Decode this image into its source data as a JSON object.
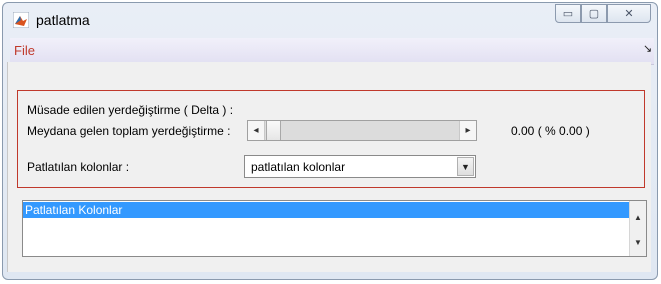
{
  "window": {
    "title": "patlatma",
    "icon": "matlab-icon",
    "controls": {
      "minimize": "▭",
      "maximize": "▢",
      "close": "✕"
    }
  },
  "menubar": {
    "items": [
      {
        "label": "File"
      }
    ],
    "overflow_glyph": "↘"
  },
  "panel": {
    "delta_label": "Müsade edilen yerdeğiştirme ( Delta ) :",
    "total_label": "Meydana gelen toplam yerdeğiştirme :",
    "slider": {
      "value": 0.0,
      "left_arrow": "◂",
      "right_arrow": "▸"
    },
    "value_text": "0.00  ( % 0.00 )",
    "columns_label": "Patlatılan kolonlar :",
    "columns_select": {
      "selected": "patlatılan kolonlar",
      "arrow": "▼"
    }
  },
  "listbox": {
    "items": [
      {
        "label": "Patlatılan Kolonlar",
        "selected": true
      }
    ],
    "scroll_up": "▲",
    "scroll_down": "▼"
  },
  "colors": {
    "panel_border": "#c0392b",
    "menu_text": "#c0392b",
    "selection": "#3399ff"
  }
}
